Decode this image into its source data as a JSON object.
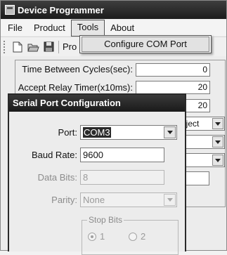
{
  "window": {
    "title": "Device Programmer"
  },
  "menu": {
    "items": [
      {
        "label": "File"
      },
      {
        "label": "Product"
      },
      {
        "label": "Tools",
        "active": true
      },
      {
        "label": "About"
      }
    ],
    "tools_dropdown": [
      {
        "label": "Configure COM Port"
      }
    ]
  },
  "toolbar": {
    "icons": [
      "new-file-icon",
      "open-folder-icon",
      "save-icon"
    ],
    "truncated_text": "Pro"
  },
  "main_form": {
    "fields": [
      {
        "label": "Time Between Cycles(sec):",
        "value": "0"
      },
      {
        "label": "Accept Relay Timer(x10ms):",
        "value": "20"
      },
      {
        "label": "",
        "value": "20"
      }
    ],
    "reject_combo_value": "eject"
  },
  "dialog": {
    "title": "Serial Port Configuration",
    "port": {
      "label": "Port:",
      "value": "COM3"
    },
    "baud_rate": {
      "label": "Baud Rate:",
      "value": "9600"
    },
    "data_bits": {
      "label": "Data Bits:",
      "value": "8"
    },
    "parity": {
      "label": "Parity:",
      "value": "None"
    },
    "stop_bits": {
      "legend": "Stop Bits",
      "options": [
        {
          "label": "1",
          "checked": true
        },
        {
          "label": "2",
          "checked": false
        }
      ]
    }
  }
}
